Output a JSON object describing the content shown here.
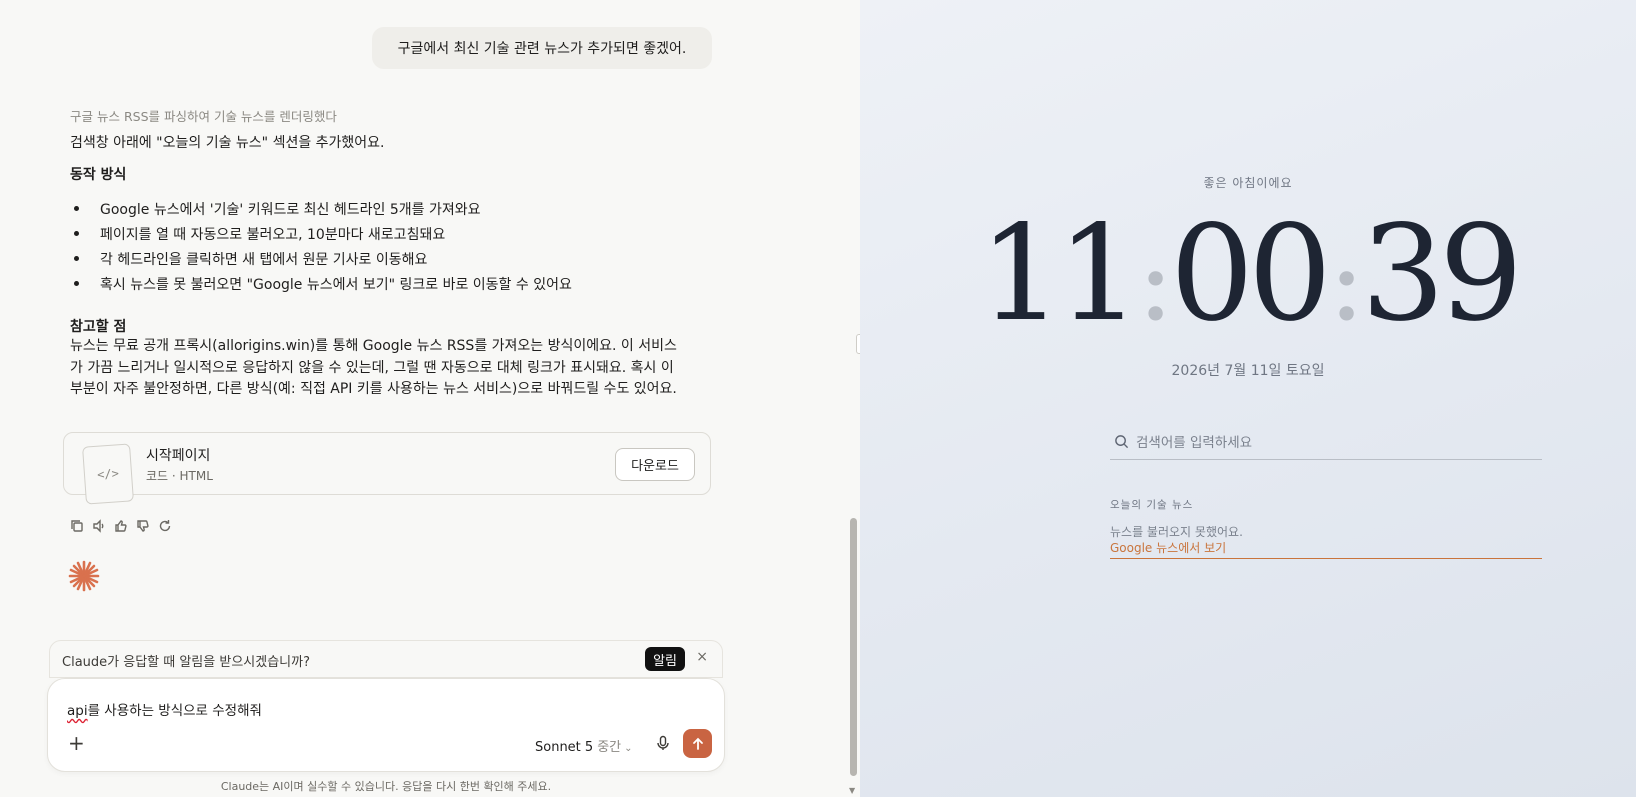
{
  "chat": {
    "user_message": "구글에서 최신 기술 관련 뉴스가 추가되면 좋겠어.",
    "thought": "구글 뉴스 RSS를 파싱하여 기술 뉴스를 렌더링했다",
    "intro": "검색창 아래에 \"오늘의 기술 뉴스\" 섹션을 추가했어요.",
    "heading_how": "동작 방식",
    "bullets": [
      "Google 뉴스에서 '기술' 키워드로 최신 헤드라인 5개를 가져와요",
      "페이지를 열 때 자동으로 불러오고, 10분마다 새로고침돼요",
      "각 헤드라인을 클릭하면 새 탭에서 원문 기사로 이동해요",
      "혹시 뉴스를 못 불러오면 \"Google 뉴스에서 보기\" 링크로 바로 이동할 수 있어요"
    ],
    "heading_note": "참고할 점",
    "note": "뉴스는 무료 공개 프록시(allorigins.win)를 통해 Google 뉴스 RSS를 가져오는 방식이에요. 이 서비스가 가끔 느리거나 일시적으로 응답하지 않을 수 있는데, 그럴 땐 자동으로 대체 링크가 표시돼요. 혹시 이 부분이 자주 불안정하면, 다른 방식(예: 직접 API 키를 사용하는 뉴스 서비스)으로 바꿔드릴 수도 있어요.",
    "artifact": {
      "title": "시작페이지",
      "subtitle": "코드 · HTML",
      "download_label": "다운로드",
      "thumb_glyph": "</>"
    },
    "notification": {
      "text": "Claude가 응답할 때 알림을 받으시겠습니까?",
      "button": "알림",
      "close": "×"
    },
    "composer": {
      "value_err": "api",
      "value_rest": "를 사용하는 방식으로 수정해줘",
      "plus": "+",
      "model": "Sonnet 5",
      "effort": "중간"
    },
    "disclaimer": "Claude는 AI이며 실수할 수 있습니다. 응답을 다시 한번 확인해 주세요.",
    "accent_color": "#c96442"
  },
  "preview": {
    "greeting": "좋은 아침이에요",
    "clock": {
      "hh": "11",
      "mm": "00",
      "ss": "39"
    },
    "date": "2026년 7월 11일 토요일",
    "search_placeholder": "검색어를 입력하세요",
    "news_label": "오늘의 기술 뉴스",
    "news_error": "뉴스를 불러오지 못했어요.",
    "news_link": "Google 뉴스에서 보기",
    "link_color": "#c9743c"
  }
}
